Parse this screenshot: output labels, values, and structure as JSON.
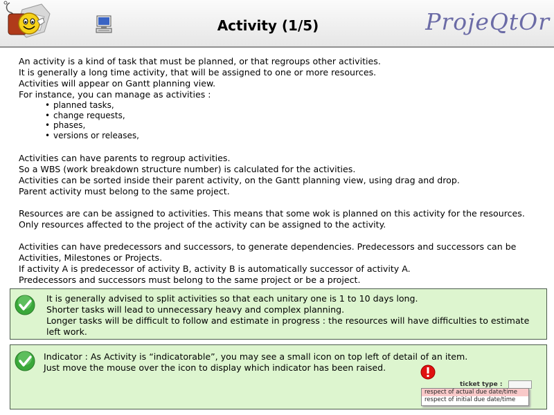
{
  "header": {
    "title": "Activity (1/5)",
    "logo": "ProjeQtOr"
  },
  "intro": [
    "An activity is a kind of task that must be planned, or that regroups other activities.",
    "It is generally a long time activity, that will be assigned to one or more resources.",
    "Activities will appear on Gantt planning view.",
    "For instance, you can manage as activities :"
  ],
  "examples": [
    "planned tasks,",
    "change requests,",
    "phases,",
    "versions or releases,"
  ],
  "parents": [
    "Activities can have parents to regroup activities.",
    "So a WBS (work breakdown structure number) is calculated for the activities.",
    "Activities can be sorted inside their parent activity, on the Gantt planning view, using drag and drop.",
    "Parent activity must belong to the same project."
  ],
  "resources": [
    "Resources are can be assigned to activities. This means that some wok is planned on this activity for the resources. Only resources affected to the project of the activity can be assigned to the activity."
  ],
  "dependencies": [
    "Activities can have predecessors and successors, to generate dependencies. Predecessors and successors can be Activities, Milestones or Projects.",
    "If activity A is predecessor of activity B, activity B is automatically successor of activity A.",
    "Predecessors and successors must belong to the same project or be a project."
  ],
  "tip1": [
    "It is generally advised to split activities so that each unitary one is 1 to 10 days long.",
    "Shorter tasks will lead to unnecessary heavy and complex planning.",
    "Longer tasks will be difficult to follow and estimate in progress : the resources will have difficulties to estimate left work."
  ],
  "tip2": [
    "Indicator : As Activity is “indicatorable”, you may see a small icon on top left of detail of an item.",
    "Just move the mouse over the icon to display which indicator has been raised."
  ],
  "indicator_example": {
    "field_label": "ticket type :",
    "line1": "respect of actual due date/time",
    "line2": "respect of initial due date/time"
  },
  "colors": {
    "tip_background": "#ddf5cf",
    "logo": "#6b6ba6",
    "alert": "#e01010",
    "check": "#3aa83a"
  }
}
